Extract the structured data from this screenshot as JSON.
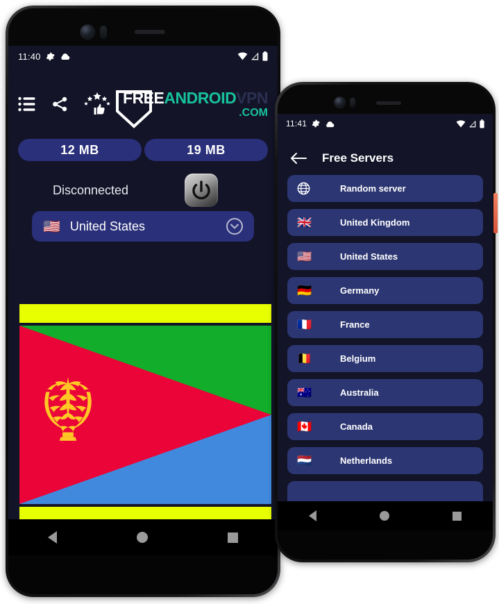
{
  "colors": {
    "screen_bg": "#131428",
    "pill_bg": "#2a3079",
    "list_item_bg": "#2c3672",
    "accent_teal": "#17c29a",
    "ad_yellow": "#e8ff00",
    "flag_red": "#ea0437",
    "flag_green": "#12ad2b",
    "flag_blue": "#4189dd",
    "flag_gold": "#ffc726",
    "side_button": "#e06a4a"
  },
  "phone1": {
    "status_bar": {
      "time": "11:40",
      "left_icons": [
        "gear-icon",
        "cloud-icon"
      ],
      "right_icons": [
        "wifi-icon",
        "signal-icon",
        "battery-icon"
      ]
    },
    "toolbar": {
      "icons": [
        {
          "name": "list-icon",
          "label": "List"
        },
        {
          "name": "share-icon",
          "label": "Share"
        },
        {
          "name": "rate-icon",
          "label": "Rate"
        }
      ]
    },
    "logo": {
      "part1": "FREE",
      "part2": "ANDROID",
      "part3": "VPN",
      "part4": ".COM"
    },
    "stats": {
      "download": "12 MB",
      "upload": "19 MB"
    },
    "connection": {
      "status": "Disconnected",
      "power_button": "power-icon"
    },
    "country_selector": {
      "flag": "🇺🇸",
      "name": "United States",
      "chevron": "chevron-down-icon"
    },
    "banner": {
      "top_band_color": "#e8ff00",
      "bottom_band_color": "#e8ff00",
      "flag_name": "Eritrea"
    },
    "nav_bar": [
      "back-triangle",
      "home-circle",
      "recents-square"
    ]
  },
  "phone2": {
    "status_bar": {
      "time": "11:41",
      "left_icons": [
        "gear-icon",
        "cloud-icon"
      ],
      "right_icons": [
        "wifi-icon",
        "signal-icon",
        "battery-icon"
      ]
    },
    "app_bar": {
      "back": "back-arrow-icon",
      "title": "Free Servers"
    },
    "servers": [
      {
        "icon": "globe-icon",
        "flag": "",
        "name": "Random server"
      },
      {
        "icon": "flag",
        "flag": "🇬🇧",
        "name": "United Kingdom"
      },
      {
        "icon": "flag",
        "flag": "🇺🇸",
        "name": "United States"
      },
      {
        "icon": "flag",
        "flag": "🇩🇪",
        "name": "Germany"
      },
      {
        "icon": "flag",
        "flag": "🇫🇷",
        "name": "France"
      },
      {
        "icon": "flag",
        "flag": "🇧🇪",
        "name": "Belgium"
      },
      {
        "icon": "flag",
        "flag": "🇦🇺",
        "name": "Australia"
      },
      {
        "icon": "flag",
        "flag": "🇨🇦",
        "name": "Canada"
      },
      {
        "icon": "flag",
        "flag": "🇳🇱",
        "name": "Netherlands"
      }
    ],
    "nav_bar": [
      "back-triangle",
      "home-circle",
      "recents-square"
    ]
  }
}
